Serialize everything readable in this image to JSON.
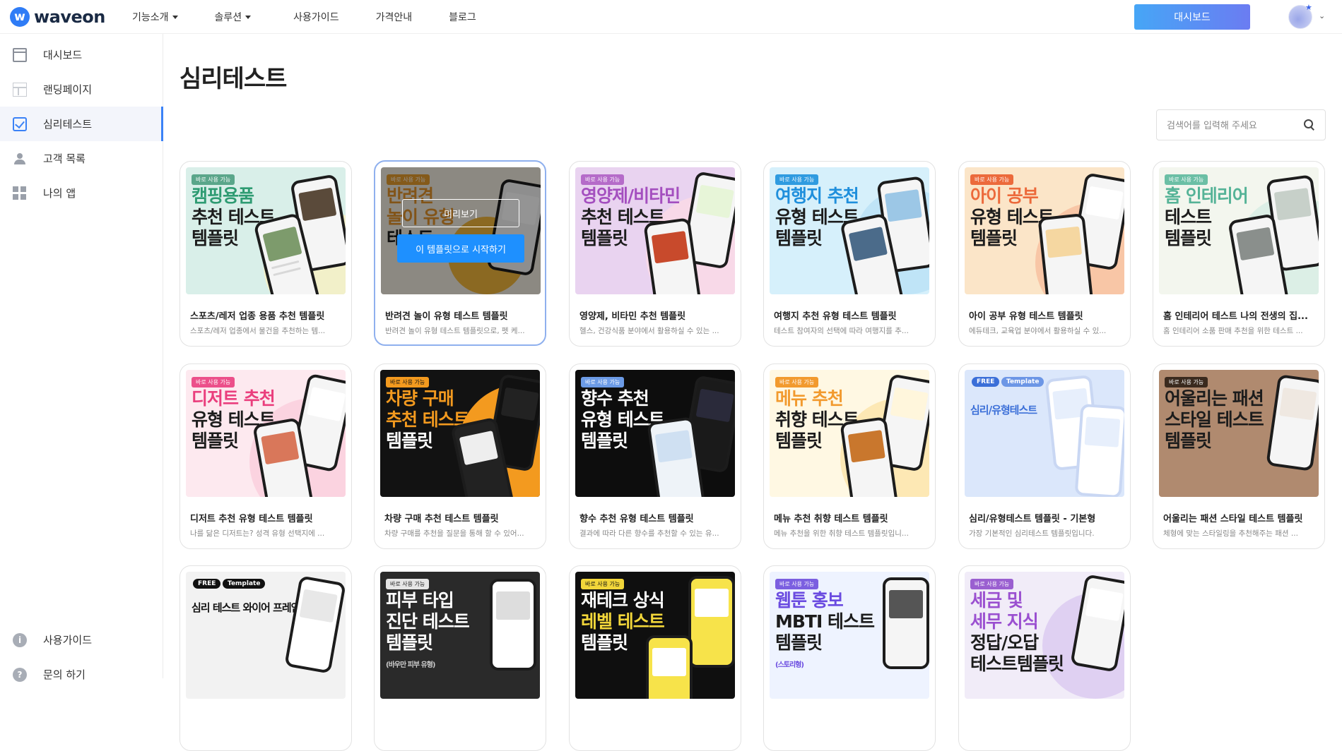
{
  "header": {
    "logo_mark": "w",
    "logo_text": "waveon",
    "nav": [
      "기능소개",
      "솔루션",
      "사용가이드",
      "가격안내",
      "블로그"
    ],
    "dashboard_button": "대시보드"
  },
  "sidebar": {
    "items": [
      {
        "label": "대시보드"
      },
      {
        "label": "랜딩페이지"
      },
      {
        "label": "심리테스트"
      },
      {
        "label": "고객 목록"
      },
      {
        "label": "나의 앱"
      }
    ],
    "bottom": [
      {
        "label": "사용가이드",
        "icon_text": "i"
      },
      {
        "label": "문의 하기",
        "icon_text": "?"
      }
    ]
  },
  "main": {
    "title": "심리테스트",
    "search_placeholder": "검색어를 입력해 주세요"
  },
  "overlay": {
    "preview": "미리보기",
    "start": "이 템플릿으로 시작하기"
  },
  "cards": [
    {
      "badge": "바로 사용 가능",
      "lines": [
        "캠핑용품",
        "추천 테스트",
        "템플릿"
      ],
      "title": "스포츠/레저 업종 용품 추천 템플릿",
      "desc": "스포츠/레저 업종에서 물건을 추천하는 템..."
    },
    {
      "badge": "바로 사용 가능",
      "lines": [
        "반려견",
        "놀이 유형",
        "테스트"
      ],
      "title": "반려견 놀이 유형 테스트 템플릿",
      "desc": "반려견 놀이 유형 테스트 템플릿으로, 펫 케..."
    },
    {
      "badge": "바로 사용 가능",
      "lines": [
        "영양제/비타민",
        "추천 테스트",
        "템플릿"
      ],
      "title": "영양제, 비타민 추천 템플릿",
      "desc": "헬스, 건강식품 분야에서 활용하실 수 있는 ..."
    },
    {
      "badge": "바로 사용 가능",
      "lines": [
        "여행지 추천",
        "유형 테스트",
        "템플릿"
      ],
      "title": "여행지 추천 유형 테스트 템플릿",
      "desc": "테스트 참여자의 선택에 따라 여행지를 추..."
    },
    {
      "badge": "바로 사용 가능",
      "lines": [
        "아이 공부",
        "유형 테스트",
        "템플릿"
      ],
      "title": "아이 공부 유형 테스트 템플릿",
      "desc": "에듀테크, 교육업 분야에서 활용하실 수 있..."
    },
    {
      "badge": "바로 사용 가능",
      "lines": [
        "홈 인테리어",
        "테스트",
        "템플릿"
      ],
      "title": "홈 인테리어 테스트 나의 전생의 집...",
      "desc": "홈 인테리어 소품 판매 추천을 위한 테스트 ..."
    },
    {
      "badge": "바로 사용 가능",
      "lines": [
        "디저트 추천",
        "유형 테스트",
        "템플릿"
      ],
      "title": "디저트 추천 유형 테스트 템플릿",
      "desc": "나를 닮은 디저트는? 성격 유형 선택지에 ..."
    },
    {
      "badge": "바로 사용 가능",
      "lines": [
        "차량 구매",
        "추천 테스트",
        "템플릿"
      ],
      "title": "차량 구매 추천 테스트 템플릿",
      "desc": "차량 구매를 추천을 질문을 통해 할 수 있어..."
    },
    {
      "badge": "바로 사용 가능",
      "lines": [
        "향수 추천",
        "유형 테스트",
        "템플릿"
      ],
      "title": "향수 추천 유형 테스트 템플릿",
      "desc": "결과에 따라 다른 향수를 추천할 수 있는 유..."
    },
    {
      "badge": "바로 사용 가능",
      "lines": [
        "메뉴 추천",
        "취향 테스트",
        "템플릿"
      ],
      "title": "메뉴 추천 취향 테스트 템플릿",
      "desc": "메뉴 추천을 위한 취향 테스트 템플릿입니..."
    },
    {
      "badge": "",
      "chip_free": "FREE",
      "chip_template": "Template",
      "lines": [
        "심리/유형테스트"
      ],
      "title": "심리/유형테스트 템플릿 - 기본형",
      "desc": "가장 기본적인 심리테스트 템플릿입니다."
    },
    {
      "badge": "바로 사용 가능",
      "lines": [
        "어울리는 패션",
        "스타일 테스트",
        "템플릿"
      ],
      "title": "어울리는 패션 스타일 테스트 템플릿",
      "desc": "체형에 맞는 스타일링을 추천해주는 패션 ..."
    },
    {
      "badge": "",
      "chip_free": "FREE",
      "chip_template": "Template",
      "lines": [
        "심리 테스트 와이어 프레임"
      ],
      "title": "",
      "desc": ""
    },
    {
      "badge": "바로 사용 가능",
      "lines": [
        "피부 타입",
        "진단 테스트",
        "템플릿"
      ],
      "sub": "(바우만 피부 유형)",
      "title": "",
      "desc": ""
    },
    {
      "badge": "바로 사용 가능",
      "lines": [
        "재테크 상식",
        "레벨 테스트",
        "템플릿"
      ],
      "title": "",
      "desc": ""
    },
    {
      "badge": "바로 사용 가능",
      "lines": [
        "웹툰 홍보",
        "MBTI 테스트",
        "템플릿"
      ],
      "sub": "(스토리형)",
      "title": "",
      "desc": ""
    },
    {
      "badge": "바로 사용 가능",
      "lines": [
        "세금 및",
        "세무 지식",
        "정답/오답",
        "테스트템플릿"
      ],
      "title": "",
      "desc": ""
    }
  ],
  "colors": {
    "accent": "#3b82f6",
    "start_button": "#1e90ff"
  }
}
